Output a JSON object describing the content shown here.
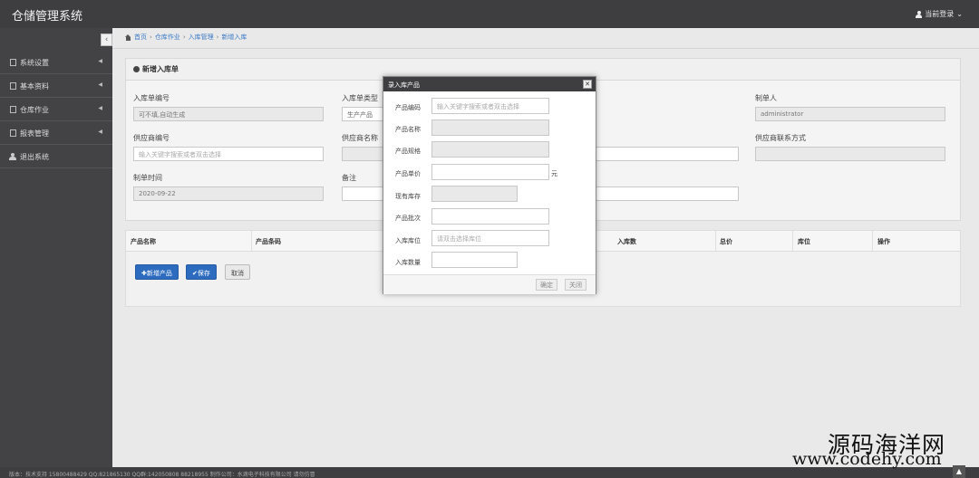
{
  "app": {
    "title": "仓储管理系统",
    "user_menu": "当前登录"
  },
  "sidebar": {
    "toggle": "‹",
    "items": [
      {
        "label": "系统设置"
      },
      {
        "label": "基本资料"
      },
      {
        "label": "仓库作业"
      },
      {
        "label": "报表管理"
      },
      {
        "label": "退出系统"
      }
    ]
  },
  "breadcrumb": [
    "首页",
    "仓库作业",
    "入库管理",
    "新增入库"
  ],
  "panel": {
    "title": "新增入库单",
    "fields": {
      "order_no": {
        "label": "入库单编号",
        "placeholder": "可不填,自动生成"
      },
      "order_type": {
        "label": "入库单类型",
        "value": "生产产品"
      },
      "maker": {
        "label": "制单人",
        "value": "administrator"
      },
      "supplier_no": {
        "label": "供应商编号",
        "placeholder": "输入关键字搜索或者双击选择"
      },
      "supplier_name": {
        "label": "供应商名称"
      },
      "supplier_contact": {
        "label": "供应商联系方式"
      },
      "create_time": {
        "label": "制单时间",
        "value": "2020-09-22"
      },
      "remark": {
        "label": "备注"
      }
    }
  },
  "table": {
    "columns": [
      "产品名称",
      "产品条码",
      "入库数",
      "总价",
      "库位",
      "操作"
    ]
  },
  "buttons": {
    "add_product": "✚新增产品",
    "save": "✔保存",
    "cancel": "取消"
  },
  "modal": {
    "title": "录入库产品",
    "close": "✕",
    "fields": {
      "code": {
        "label": "产品编码",
        "placeholder": "输入关键字搜索或者双击选择"
      },
      "name": {
        "label": "产品名称"
      },
      "spec": {
        "label": "产品规格"
      },
      "price": {
        "label": "产品单价",
        "unit": "元"
      },
      "stock": {
        "label": "现有库存"
      },
      "batch": {
        "label": "产品批次"
      },
      "location": {
        "label": "入库库位",
        "placeholder": "请双击选择库位"
      },
      "qty": {
        "label": "入库数量"
      }
    },
    "ok": "确定",
    "close_btn": "关闭"
  },
  "footer": "版本：技术支持 15800488429  QQ:821865130  QQ群:142050808  88218955  制作公司：水滴电子科技有限公司 请勿仿冒",
  "scroll_top": "▲",
  "watermark": {
    "line1": "源码海洋网",
    "line2": "www.codehy.com"
  }
}
